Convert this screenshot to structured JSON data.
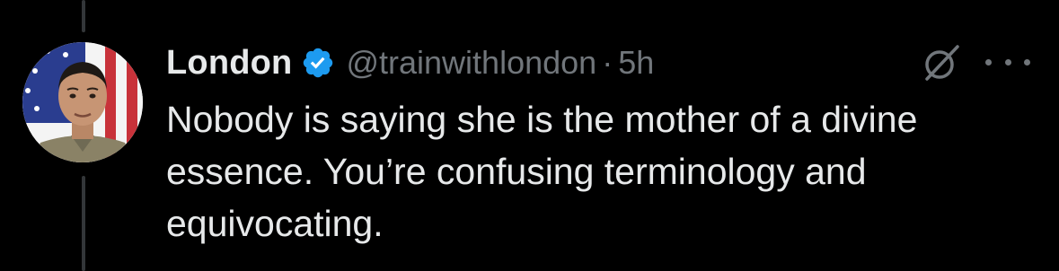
{
  "tweet": {
    "author": {
      "display_name": "London",
      "handle": "@trainwithlondon",
      "verified": true,
      "avatar_icon": "profile-photo-soldier-flag"
    },
    "separator": "·",
    "time": "5h",
    "text_lines": [
      "Nobody is saying she is the mother of a divine",
      "essence. You’re confusing terminology and",
      "equivocating."
    ],
    "actions": {
      "grok_icon": "grok-icon",
      "more_icon": "more-options-icon"
    }
  },
  "colors": {
    "background": "#000000",
    "primary_text": "#e7e9ea",
    "secondary_text": "#71767b",
    "verified_badge": "#1d9bf0",
    "thread_line": "#333639"
  }
}
